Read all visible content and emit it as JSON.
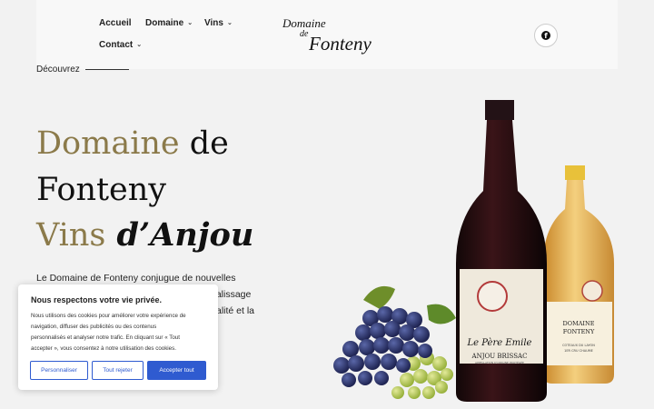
{
  "nav": {
    "accueil": "Accueil",
    "domaine": "Domaine",
    "vins": "Vins",
    "contact": "Contact"
  },
  "logo": {
    "line1": "Domaine",
    "line2": "de",
    "line3": "Fonteny"
  },
  "social": {
    "icon": "facebook-icon",
    "glyph": "f"
  },
  "discover": "Découvrez",
  "hero": {
    "line1_a": "Domaine",
    "line1_b": " de",
    "line2": "Fonteny",
    "line3_a": "Vins",
    "line3_b": " d’Anjou"
  },
  "paragraph": {
    "line1": "Le Domaine de Fonteny conjugue de nouvelles",
    "line2_end": "palissage",
    "line3_end": "alité et la"
  },
  "bottles": {
    "red_label_script": "Le Père Emile",
    "red_label_name": "ANJOU BRISSAC",
    "red_label_sub": "APPELLATION D'ORIGINE PROTÉGÉE",
    "white_label_line1": "DOMAINE",
    "white_label_line2": "FONTENY",
    "white_label_sub1": "COTEAUX DU LAYON",
    "white_label_sub2": "1ER CRU CHAUME"
  },
  "cookie": {
    "title": "Nous respectons votre vie privée.",
    "text1": "Nous utilisons des cookies pour améliorer votre expérience de",
    "text2": "navigation, diffuser des publicités ou des contenus",
    "text3": "personnalisés et analyser notre trafic. En cliquant sur « Tout",
    "text4": "accepter », vous consentez à notre utilisation des cookies.",
    "btn_customize": "Personnaliser",
    "btn_reject": "Tout rejeter",
    "btn_accept": "Accepter tout"
  },
  "colors": {
    "gold": "#8b7a4a",
    "button_blue": "#2f5bd0",
    "background": "#f2f2f2"
  }
}
